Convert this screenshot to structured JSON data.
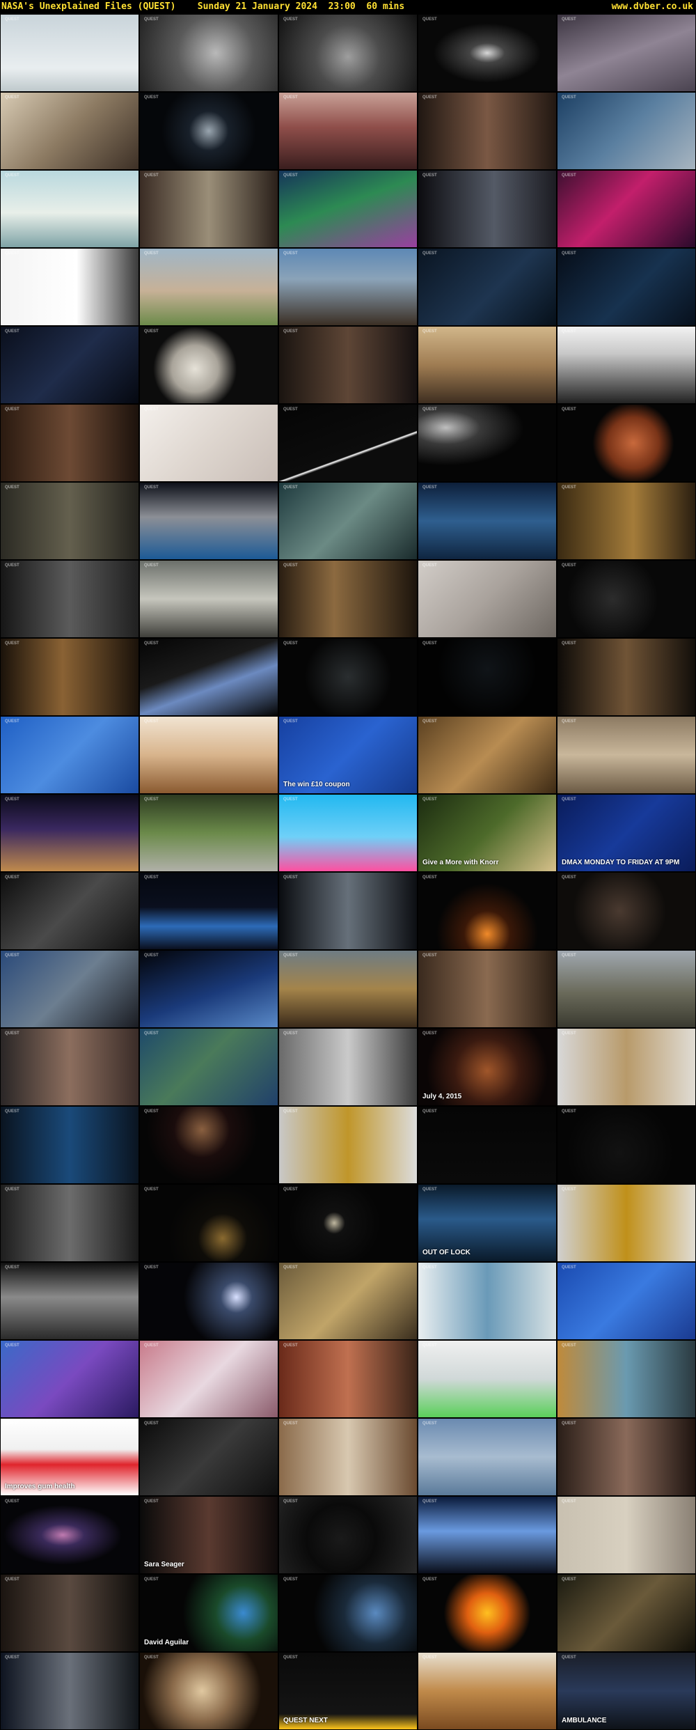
{
  "header": {
    "title": "NASA's Unexplained Files (QUEST)    Sunday 21 January 2024  23:00  60 mins",
    "site": "www.dvber.co.uk"
  },
  "channel_watermark": "QUEST",
  "thumbnails": [
    {
      "bg": "linear-gradient(180deg,#c9d4da 0%,#e9eef0 70%,#bfc9cc 100%)",
      "cap": ""
    },
    {
      "bg": "radial-gradient(circle at 55% 50%,#b9b9b9 0%,#5a5a5a 45%,#222 100%)",
      "cap": ""
    },
    {
      "bg": "radial-gradient(circle at 50% 55%,#9e9e9e 0%,#4c4c4c 40%,#111 100%)",
      "cap": ""
    },
    {
      "bg": "radial-gradient(ellipse at 50% 50%,#d8d8d8 0%,#444 18%,#080808 55%)",
      "cap": ""
    },
    {
      "bg": "linear-gradient(160deg,#3b3440 0%,#8f8494 50%,#4a4350 100%)",
      "cap": ""
    },
    {
      "bg": "linear-gradient(135deg,#d8cbb4 0%,#8c7a62 50%,#3d3026 100%)",
      "cap": ""
    },
    {
      "bg": "radial-gradient(circle at 50% 50%,#9aa6b0 0%,#18202a 25%,#05070a 60%)",
      "cap": ""
    },
    {
      "bg": "linear-gradient(180deg,#c9a197 0%,#8f4e4a 45%,#3a1e1e 100%)",
      "cap": ""
    },
    {
      "bg": "linear-gradient(90deg,#201712 0%,#7a5844 50%,#221812 100%)",
      "cap": ""
    },
    {
      "bg": "linear-gradient(135deg,#1c3f63 0%,#5a7fa0 50%,#a8b5c0 100%)",
      "cap": ""
    },
    {
      "bg": "linear-gradient(180deg,#b9d8de 0%,#e8efe9 55%,#7ea3a6 100%)",
      "cap": ""
    },
    {
      "bg": "linear-gradient(90deg,#3a2c24 0%,#9a8e78 50%,#2a201a 100%)",
      "cap": ""
    },
    {
      "bg": "linear-gradient(160deg,#15355a 0%,#2d8a53 45%,#9a3fa0 100%)",
      "cap": ""
    },
    {
      "bg": "linear-gradient(90deg,#0c0c10 0%,#545a66 55%,#1c1c22 100%)",
      "cap": ""
    },
    {
      "bg": "linear-gradient(135deg,#3d1030 0%,#c21f6b 45%,#2a0a2b 100%)",
      "cap": ""
    },
    {
      "bg": "linear-gradient(90deg,#f4f4f4 0%,#ffffff 55%,#3a3a3a 100%)",
      "cap": ""
    },
    {
      "bg": "linear-gradient(180deg,#9fb6c7 0%,#c7b197 55%,#6c8a4a 100%)",
      "cap": ""
    },
    {
      "bg": "linear-gradient(180deg,#5d88b5 0%,#8ba3b8 40%,#3b2f24 100%)",
      "cap": ""
    },
    {
      "bg": "linear-gradient(135deg,#0a1522 0%,#1e3550 55%,#06101a 100%)",
      "cap": ""
    },
    {
      "bg": "linear-gradient(135deg,#060d18 0%,#17324f 55%,#07101c 100%)",
      "cap": ""
    },
    {
      "bg": "linear-gradient(135deg,#0a0f1c 0%,#1f2c4a 50%,#050810 100%)",
      "cap": ""
    },
    {
      "bg": "radial-gradient(circle at 40% 55%,#e6e2d8 0%,#a9a49a 25%,#0c0c0c 45%)",
      "cap": ""
    },
    {
      "bg": "linear-gradient(90deg,#1a1410 0%,#5e4636 50%,#151010 100%)",
      "cap": ""
    },
    {
      "bg": "linear-gradient(180deg,#d1b68a 0%,#9f7c52 50%,#3e2e20 100%)",
      "cap": ""
    },
    {
      "bg": "linear-gradient(180deg,#f2f2f2 0%,#c8c8c8 35%,#222 100%)",
      "cap": ""
    },
    {
      "bg": "linear-gradient(90deg,#2a1a10 0%,#6d4a34 50%,#1c120c 100%)",
      "cap": ""
    },
    {
      "bg": "linear-gradient(135deg,#f4f0ec 0%,#ded6cf 50%,#c8bdb6 100%)",
      "cap": ""
    },
    {
      "bg": "linear-gradient(160deg,#050505 0%,#0c0c0c 60%,#ffffff 61%,#0c0c0c 63%)",
      "cap": ""
    },
    {
      "bg": "radial-gradient(ellipse at 20% 30%,#bfbfbf 0%,#3a3a3a 22%,#050505 50%)",
      "cap": ""
    },
    {
      "bg": "radial-gradient(circle at 55% 50%,#c8693c 0%,#7a3418 30%,#050505 48%)",
      "cap": ""
    },
    {
      "bg": "linear-gradient(90deg,#2b2a23 0%,#64604e 50%,#22211c 100%)",
      "cap": ""
    },
    {
      "bg": "linear-gradient(180deg,#0c0f18 0%,#8c8f96 45%,#1c5a96 100%)",
      "cap": ""
    },
    {
      "bg": "linear-gradient(135deg,#1e3a3e 0%,#6b8a84 50%,#1a2b2c 100%)",
      "cap": ""
    },
    {
      "bg": "linear-gradient(180deg,#0d1f3a 0%,#2f5f8f 50%,#0f2540 100%)",
      "cap": ""
    },
    {
      "bg": "linear-gradient(90deg,#3a2a12 0%,#a47c3a 55%,#2a1e10 100%)",
      "cap": ""
    },
    {
      "bg": "linear-gradient(90deg,#161616 0%,#5b5b5b 50%,#202020 100%)",
      "cap": ""
    },
    {
      "bg": "linear-gradient(180deg,#6b6f6a 0%,#c6c6bd 50%,#3f3f3a 100%)",
      "cap": ""
    },
    {
      "bg": "linear-gradient(90deg,#2a1e12 0%,#8c6a40 40%,#1c140c 100%)",
      "cap": ""
    },
    {
      "bg": "linear-gradient(135deg,#d2cdc8 0%,#a9a29c 50%,#6c6660 100%)",
      "cap": ""
    },
    {
      "bg": "radial-gradient(circle at 40% 50%,#2c2c2c 0%,#080808 50%)",
      "cap": ""
    },
    {
      "bg": "linear-gradient(90deg,#1a120a 0%,#8a6234 45%,#1a120a 100%)",
      "cap": ""
    },
    {
      "bg": "linear-gradient(160deg,#050505 0%,#1a1a1a 40%,#6c8ac0 60%,#050505 100%)",
      "cap": ""
    },
    {
      "bg": "radial-gradient(circle at 50% 50%,#2a2e30 0%,#050505 55%)",
      "cap": ""
    },
    {
      "bg": "radial-gradient(circle at 50% 40%,#101418 0%,#020202 60%)",
      "cap": ""
    },
    {
      "bg": "linear-gradient(90deg,#0e0b08 0%,#705436 50%,#120e0a 100%)",
      "cap": ""
    },
    {
      "bg": "linear-gradient(135deg,#1f5fc4 0%,#4d8ce0 50%,#1a4aa0 100%)",
      "cap": ""
    },
    {
      "bg": "linear-gradient(180deg,#f1e4d2 0%,#d8b48c 50%,#8a5a30 100%)",
      "cap": ""
    },
    {
      "bg": "linear-gradient(135deg,#1640a0 0%,#2a63d0 50%,#153a8c 100%)",
      "cap": "The win £10 coupon"
    },
    {
      "bg": "linear-gradient(135deg,#5a4020 0%,#b88c52 50%,#3d2a14 100%)",
      "cap": ""
    },
    {
      "bg": "linear-gradient(180deg,#8c7a62 0%,#c9b79b 50%,#6b5a44 100%)",
      "cap": ""
    },
    {
      "bg": "linear-gradient(180deg,#0a0a18 0%,#3a2860 45%,#c08a4c 100%)",
      "cap": ""
    },
    {
      "bg": "linear-gradient(180deg,#2c3a20 0%,#6b8a4a 50%,#b0b0a8 100%)",
      "cap": ""
    },
    {
      "bg": "linear-gradient(180deg,#22b8f0 0%,#6fd0f8 55%,#ff4fa0 100%)",
      "cap": ""
    },
    {
      "bg": "linear-gradient(135deg,#1b2b10 0%,#4d6a2a 50%,#d6c08a 100%)",
      "cap": "Give a More with Knorr"
    },
    {
      "bg": "linear-gradient(135deg,#0a1c5a 0%,#173a9a 50%,#0a1c5a 100%)",
      "cap": "DMAX  MONDAY TO FRIDAY AT 9PM"
    },
    {
      "bg": "linear-gradient(135deg,#0c0c0c 0%,#4a4a4a 50%,#101010 100%)",
      "cap": ""
    },
    {
      "bg": "linear-gradient(180deg,#050810 0%,#0a0f1e 45%,#2d6bb8 70%,#0a0f1e 100%)",
      "cap": ""
    },
    {
      "bg": "linear-gradient(90deg,#0a0c10 0%,#66707a 50%,#0c0e12 100%)",
      "cap": ""
    },
    {
      "bg": "radial-gradient(circle at 50% 80%,#f08a2a 0%,#3a1808 25%,#050505 55%)",
      "cap": ""
    },
    {
      "bg": "radial-gradient(circle at 45% 50%,#4a3a30 0%,#0e0c0a 55%)",
      "cap": ""
    },
    {
      "bg": "linear-gradient(135deg,#2a4a7a 0%,#6c7e90 50%,#1a1c22 100%)",
      "cap": ""
    },
    {
      "bg": "linear-gradient(160deg,#030408 0%,#1a3a7a 55%,#5a8ac8 100%)",
      "cap": ""
    },
    {
      "bg": "linear-gradient(180deg,#6e7c84 0%,#a4844a 50%,#3a2a1a 100%)",
      "cap": ""
    },
    {
      "bg": "linear-gradient(90deg,#3a2a1e 0%,#8a6a50 50%,#2a1e14 100%)",
      "cap": ""
    },
    {
      "bg": "linear-gradient(180deg,#a0a8b0 0%,#6a6a5a 55%,#3a3a30 100%)",
      "cap": ""
    },
    {
      "bg": "linear-gradient(90deg,#2a2626 0%,#8c6e5e 50%,#3a2c28 100%)",
      "cap": ""
    },
    {
      "bg": "linear-gradient(135deg,#1e4a6a 0%,#4a7a5a 45%,#20406a 100%)",
      "cap": ""
    },
    {
      "bg": "linear-gradient(90deg,#6a6a6a 0%,#cacaca 50%,#3c3c3c 100%)",
      "cap": ""
    },
    {
      "bg": "radial-gradient(circle at 50% 55%,#a0562a 0%,#3a1a10 40%,#0a0505 75%)",
      "cap": "July 4, 2015"
    },
    {
      "bg": "linear-gradient(90deg,#d8d8d8 0%,#b89a6a 50%,#e0dcd4 100%)",
      "cap": ""
    },
    {
      "bg": "linear-gradient(90deg,#0a1420 0%,#1a4a7a 50%,#0a1420 100%)",
      "cap": ""
    },
    {
      "bg": "radial-gradient(circle at 45% 30%,#8a6040 0%,#1a0c0c 30%,#050505 60%)",
      "cap": ""
    },
    {
      "bg": "linear-gradient(90deg,#c8c8c8 0%,#c0962a 50%,#dcdcdc 100%)",
      "cap": ""
    },
    {
      "bg": "linear-gradient(180deg,#050505 0%,#0a0a0a 100%)",
      "cap": ""
    },
    {
      "bg": "radial-gradient(circle at 45% 60%,#121212 0%,#050505 60%)",
      "cap": ""
    },
    {
      "bg": "linear-gradient(90deg,#1e1e1e 0%,#6c6c6c 50%,#1a1a1a 100%)",
      "cap": ""
    },
    {
      "bg": "radial-gradient(circle at 60% 70%,#8a6a30 0%,#0e0c08 25%,#050505 55%)",
      "cap": ""
    },
    {
      "bg": "radial-gradient(circle at 40% 50%,#c0b8a0 0%,#101010 12%,#050505 50%)",
      "cap": ""
    },
    {
      "bg": "linear-gradient(180deg,#0a1a2a 0%,#2a5a8a 45%,#0a1a2a 100%)",
      "cap": "OUT OF LOCK"
    },
    {
      "bg": "linear-gradient(90deg,#d0d0d0 0%,#c0901a 50%,#e0dcd4 100%)",
      "cap": ""
    },
    {
      "bg": "linear-gradient(180deg,#101010 0%,#8a8a8a 45%,#2a2a2a 100%)",
      "cap": ""
    },
    {
      "bg": "radial-gradient(circle at 70% 45%,#d8e0ff 0%,#3a4a6a 15%,#050508 50%)",
      "cap": ""
    },
    {
      "bg": "linear-gradient(135deg,#6a5a3a 0%,#c0a468 50%,#3a2e1e 100%)",
      "cap": ""
    },
    {
      "bg": "linear-gradient(90deg,#e8eef0 0%,#6a9ab8 50%,#d8e2e4 100%)",
      "cap": ""
    },
    {
      "bg": "linear-gradient(135deg,#1a4ab0 0%,#3a7ae0 50%,#1a3a90 100%)",
      "cap": ""
    },
    {
      "bg": "linear-gradient(135deg,#3a6ac8 0%,#7a4ac0 50%,#2a1a60 100%)",
      "cap": ""
    },
    {
      "bg": "linear-gradient(135deg,#c87a8a 0%,#e8d8e0 50%,#8a5a6a 100%)",
      "cap": ""
    },
    {
      "bg": "linear-gradient(90deg,#6a2a1a 0%,#c07050 50%,#3a2418 100%)",
      "cap": ""
    },
    {
      "bg": "linear-gradient(180deg,#f0f0f0 0%,#d0d8d8 50%,#5ad05a 100%)",
      "cap": ""
    },
    {
      "bg": "linear-gradient(90deg,#c08a3a 0%,#6a9ab0 50%,#2a3a40 100%)",
      "cap": ""
    },
    {
      "bg": "linear-gradient(180deg,#ffffff 0%,#f0f0f0 40%,#e0242c 60%,#ffffff 100%)",
      "cap": "Improves gum health"
    },
    {
      "bg": "linear-gradient(135deg,#0a0a0a 0%,#3a3a3a 50%,#0e0e0e 100%)",
      "cap": ""
    },
    {
      "bg": "linear-gradient(90deg,#8a6a4a 0%,#d8c8b0 50%,#6a4a30 100%)",
      "cap": ""
    },
    {
      "bg": "linear-gradient(180deg,#6a8ab0 0%,#a8bcd0 50%,#5a7a9a 100%)",
      "cap": ""
    },
    {
      "bg": "linear-gradient(90deg,#2a1e18 0%,#8a6a5a 50%,#1e1410 100%)",
      "cap": ""
    },
    {
      "bg": "radial-gradient(ellipse at 45% 50%,#c07ab0 0%,#3a2a5a 20%,#050508 55%)",
      "cap": ""
    },
    {
      "bg": "linear-gradient(90deg,#0a0a0a 0%,#5a3a30 50%,#0e0a0a 100%)",
      "cap": "Sara Seager"
    },
    {
      "bg": "radial-gradient(circle at 45% 55%,#1a1a1a 0%,#0a0a0a 40%,#2a2a2a 100%)",
      "cap": ""
    },
    {
      "bg": "linear-gradient(180deg,#0a1a3a 0%,#6a9ae0 45%,#0a0e1a 100%)",
      "cap": ""
    },
    {
      "bg": "linear-gradient(90deg,#c8c0b0 0%,#d8d0c0 50%,#8a8074 100%)",
      "cap": ""
    },
    {
      "bg": "linear-gradient(90deg,#1a1410 0%,#5a4a40 50%,#0e0c0a 100%)",
      "cap": ""
    },
    {
      "bg": "radial-gradient(circle at 75% 50%,#3a8ad0 0%,#1a4a2a 25%,#050505 55%)",
      "cap": "David Aguilar"
    },
    {
      "bg": "radial-gradient(circle at 70% 50%,#5a8ac0 0%,#1a2a3a 30%,#050505 60%)",
      "cap": ""
    },
    {
      "bg": "radial-gradient(circle at 50% 50%,#ffc020 0%,#e06010 25%,#050505 55%)",
      "cap": ""
    },
    {
      "bg": "linear-gradient(135deg,#1a1a10 0%,#6a5a3a 50%,#121008 100%)",
      "cap": ""
    },
    {
      "bg": "linear-gradient(90deg,#0e1420 0%,#6a707a 50%,#101418 100%)",
      "cap": ""
    },
    {
      "bg": "radial-gradient(circle at 45% 50%,#e0c8a0 0%,#8a6a4a 35%,#1a1008 70%)",
      "cap": ""
    },
    {
      "bg": "linear-gradient(180deg,#0a0a0a 0%,#141414 80%,#ffc61a 100%)",
      "cap": "QUEST  NEXT"
    },
    {
      "bg": "linear-gradient(180deg,#e8e0d0 0%,#c08a4a 50%,#7a4a20 100%)",
      "cap": ""
    },
    {
      "bg": "linear-gradient(180deg,#1a1e28 0%,#2a3a5a 50%,#0e1218 100%)",
      "cap": "AMBULANCE"
    }
  ]
}
